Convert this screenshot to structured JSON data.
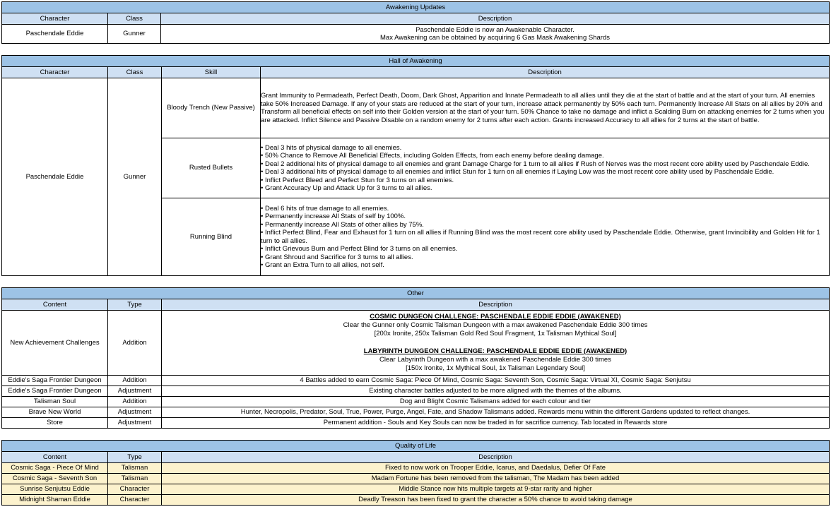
{
  "sections": {
    "awakening_updates": {
      "title": "Awakening Updates",
      "headers": [
        "Character",
        "Class",
        "Description"
      ],
      "rows": [
        {
          "character": "Paschendale Eddie",
          "class": "Gunner",
          "description_lines": [
            "Paschendale Eddie is now an Awakenable Character.",
            "Max Awakening can be obtained by acquiring 6 Gas Mask Awakening Shards"
          ]
        }
      ]
    },
    "hall_of_awakening": {
      "title": "Hall of Awakening",
      "headers": [
        "Character",
        "Class",
        "Skill",
        "Description"
      ],
      "character": "Paschendale Eddie",
      "class": "Gunner",
      "skills": [
        {
          "name": "Bloody Trench (New Passive)",
          "paragraph": "Grant Immunity to Permadeath, Perfect Death, Doom, Dark Ghost, Apparition and Innate Permadeath to all allies until they die at the start of battle and at the start of your turn. All enemies take 50% Increased Damage. If any of your stats are reduced at the start of your turn, increase attack permanently by 50% each turn. Permanently Increase All Stats on all allies by 20% and Transform all beneficial effects on self into their Golden version at the start of your turn. 50% Chance to take no damage and inflict a Scalding Burn on attacking enemies for 2 turns when you are attacked. Inflict Silence and Passive Disable on a random enemy for 2 turns after each action. Grants increased Accuracy to all allies for 2 turns at the start of battle."
        },
        {
          "name": "Rusted Bullets",
          "bullets": [
            "• Deal 3 hits of physical damage to all enemies.",
            "• 50% Chance to Remove All Beneficial Effects, including Golden Effects, from each enemy before dealing damage.",
            "• Deal 2 additional hits of physical damage to all enemies and grant Damage Charge for 1 turn to all allies if Rush of Nerves was the most recent core ability used by Paschendale Eddie.",
            "• Deal 3 additional hits of physical damage to all enemies and inflict Stun for 1 turn on all enemies if Laying Low was the most recent core ability used by Paschendale Eddie.",
            "• Inflict Perfect Bleed and Perfect Stun for 3 turns on all enemies.",
            "• Grant Accuracy Up and Attack Up for 3 turns to all allies."
          ]
        },
        {
          "name": "Running Blind",
          "bullets": [
            "• Deal 6 hits of true damage to all enemies.",
            "• Permanently increase All Stats of self by 100%.",
            "• Permanently increase All Stats of other allies by 75%.",
            "• Inflict Perfect Blind, Fear and Exhaust for 1 turn on all allies if Running Blind was the most recent core ability used by Paschendale Eddie. Otherwise, grant Invincibility and Golden Hit for 1 turn to all allies.",
            "• Inflict Grievous Burn and Perfect Blind for 3 turns on all enemies.",
            "• Grant Shroud and Sacrifice for 3 turns to all allies.",
            "• Grant an Extra Turn to all allies, not self."
          ]
        }
      ]
    },
    "other": {
      "title": "Other",
      "headers": [
        "Content",
        "Type",
        "Description"
      ],
      "achievement_row": {
        "content": "New Achievement Challenges",
        "type": "Addition",
        "blocks": [
          {
            "heading": "COSMIC DUNGEON CHALLENGE: PASCHENDALE EDDIE EDDIE (AWAKENED)",
            "lines": [
              "Clear the Gunner only Cosmic Talisman Dungeon with a max awakened Paschendale Eddie 300 times",
              "[200x Ironite, 250x Talisman Gold Red Soul Fragment, 1x Talisman Mythical Soul]"
            ]
          },
          {
            "heading": "LABYRINTH DUNGEON CHALLENGE: PASCHENDALE EDDIE EDDIE (AWAKENED)",
            "lines": [
              "Clear Labyrinth Dungeon with a max awakened Paschendale Eddie 300 times",
              "[150x Ironite, 1x Mythical Soul, 1x Talisman Legendary Soul]"
            ]
          }
        ]
      },
      "rows": [
        {
          "content": "Eddie's Saga Frontier Dungeon",
          "type": "Addition",
          "description": "4 Battles added to earn Cosmic Saga: Piece Of Mind, Cosmic Saga: Seventh Son, Cosmic Saga: Virtual XI, Cosmic Saga: Senjutsu"
        },
        {
          "content": "Eddie's Saga Frontier Dungeon",
          "type": "Adjustment",
          "description": "Existing character battles adjusted to be more aligned with the themes of the albums."
        },
        {
          "content": "Talisman Soul",
          "type": "Addition",
          "description": "Dog and Blight Cosmic Talismans added for each colour and tier"
        },
        {
          "content": "Brave New World",
          "type": "Adjustment",
          "description": "Hunter, Necropolis, Predator, Soul, True, Power, Purge, Angel, Fate, and Shadow Talismans added. Rewards menu within the different Gardens updated to reflect changes."
        },
        {
          "content": "Store",
          "type": "Adjustment",
          "description": "Permanent addition - Souls and Key Souls can now be traded in for sacrifice currency. Tab located in Rewards store"
        }
      ]
    },
    "quality_of_life": {
      "title": "Quality of Life",
      "headers": [
        "Content",
        "Type",
        "Description"
      ],
      "rows": [
        {
          "content": "Cosmic Saga - Piece Of Mind",
          "type": "Talisman",
          "description": "Fixed to now work on Trooper Eddie, Icarus, and Daedalus, Defier Of Fate"
        },
        {
          "content": "Cosmic Saga - Seventh Son",
          "type": "Talisman",
          "description": "Madam Fortune has been removed from the talisman, The Madam has been added"
        },
        {
          "content": "Sunrise Senjutsu Eddie",
          "type": "Character",
          "description": "Middle Stance now hits multiple targets at 9-star rarity and higher"
        },
        {
          "content": "Midnight Shaman Eddie",
          "type": "Character",
          "description": "Deadly Treason has been fixed to grant the character a 50% chance to avoid taking damage"
        }
      ]
    }
  },
  "colors": {
    "title_blue": "#9DC3E6",
    "header_blue": "#CFE0F3",
    "qol_cream": "#FCF2CD",
    "border": "#000000"
  }
}
